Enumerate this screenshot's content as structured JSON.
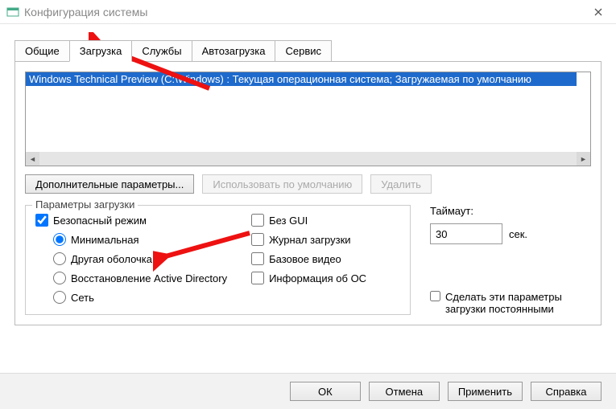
{
  "window": {
    "title": "Конфигурация системы"
  },
  "tabs": {
    "t0": "Общие",
    "t1": "Загрузка",
    "t2": "Службы",
    "t3": "Автозагрузка",
    "t4": "Сервис",
    "active": 1
  },
  "bootlist": {
    "entry0": "Windows Technical Preview (C:\\Windows) : Текущая операционная система; Загружаемая по умолчанию"
  },
  "buttons": {
    "advanced": "Дополнительные параметры...",
    "setdefault": "Использовать по умолчанию",
    "delete": "Удалить"
  },
  "group": {
    "legend": "Параметры загрузки",
    "safeboot": "Безопасный режим",
    "minimal": "Минимальная",
    "altshell": "Другая оболочка",
    "dsrepair": "Восстановление Active Directory",
    "network": "Сеть",
    "nogui": "Без GUI",
    "bootlog": "Журнал загрузки",
    "basevideo": "Базовое видео",
    "osinfo": "Информация  об ОС"
  },
  "timeout": {
    "label": "Таймаут:",
    "value": "30",
    "unit": "сек."
  },
  "permanent": "Сделать эти параметры загрузки постоянными",
  "dlg": {
    "ok": "ОК",
    "cancel": "Отмена",
    "apply": "Применить",
    "help": "Справка"
  }
}
